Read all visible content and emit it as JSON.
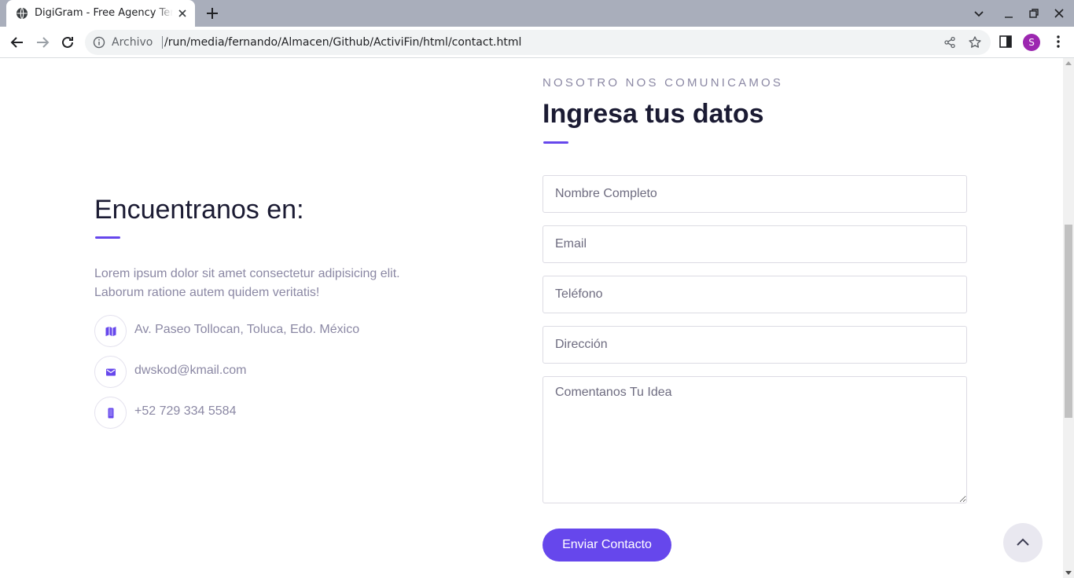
{
  "browser": {
    "tab_title": "DigiGram - Free Agency Template",
    "omnibox_prefix": "Archivo",
    "url": "/run/media/fernando/Almacen/Github/ActiviFin/html/contact.html",
    "profile_initial": "S",
    "accent_color": "#9c27b0"
  },
  "location": {
    "title": "Encuentranos en:",
    "description": "Lorem ipsum dolor sit amet consectetur adipisicing elit. Laborum ratione autem quidem veritatis!",
    "items": [
      {
        "icon": "map-icon",
        "text": "Av. Paseo Tollocan, Toluca, Edo. México"
      },
      {
        "icon": "envelope-icon",
        "text": "dwskod@kmail.com"
      },
      {
        "icon": "mobile-phone-icon",
        "text": "+52 729 334 5584"
      }
    ]
  },
  "form": {
    "eyebrow": "NOSOTRO NOS COMUNICAMOS",
    "title": "Ingresa tus datos",
    "name_placeholder": "Nombre Completo",
    "email_placeholder": "Email",
    "phone_placeholder": "Teléfono",
    "address_placeholder": "Dirección",
    "message_placeholder": "Comentanos Tu Idea",
    "submit_label": "Enviar Contacto"
  },
  "colors": {
    "brand": "#6647ec",
    "heading": "#1b1b33",
    "muted": "#8b88a4"
  }
}
